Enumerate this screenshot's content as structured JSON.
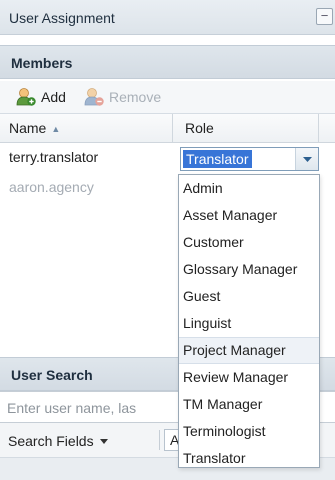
{
  "panel": {
    "title": "User Assignment",
    "collapse_icon": "minus-icon"
  },
  "members": {
    "title": "Members",
    "toolbar": {
      "add_label": "Add",
      "remove_label": "Remove"
    },
    "columns": {
      "name": "Name",
      "role": "Role"
    },
    "rows": [
      {
        "name": "terry.translator",
        "role": "Translator"
      },
      {
        "name": "aaron.agency"
      }
    ],
    "role_dropdown": {
      "options": [
        "Admin",
        "Asset Manager",
        "Customer",
        "Glossary Manager",
        "Guest",
        "Linguist",
        "Project Manager",
        "Review Manager",
        "TM Manager",
        "Terminologist",
        "Translator"
      ],
      "hovered": "Project Manager"
    }
  },
  "user_search": {
    "title": "User Search",
    "placeholder": "Enter user name, las",
    "search_fields_label": "Search Fields",
    "scope_value": "All"
  },
  "colors": {
    "selection": "#3875d7",
    "border": "#99a8b6",
    "header_bg": "#dfe6ec"
  }
}
